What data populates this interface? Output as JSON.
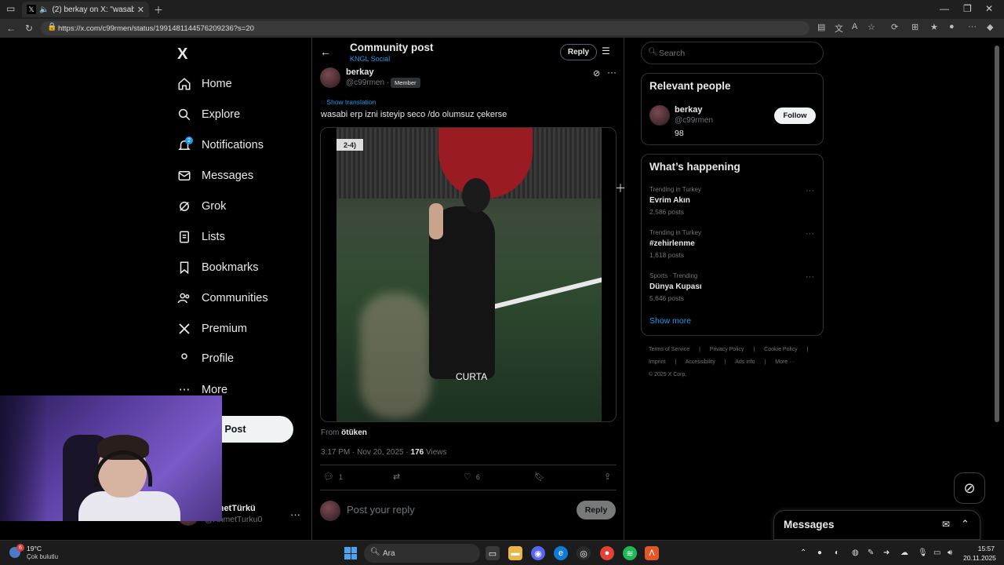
{
  "browser": {
    "tab_title": "(2) berkay on X: \"wasabi erp",
    "url": "https://x.com/c99rmen/status/1991481144576209236?s=20"
  },
  "sidebar": {
    "logo": "X",
    "items": [
      {
        "label": "Home",
        "icon": "home-icon"
      },
      {
        "label": "Explore",
        "icon": "search-icon"
      },
      {
        "label": "Notifications",
        "icon": "bell-icon",
        "badge": "2"
      },
      {
        "label": "Messages",
        "icon": "mail-icon"
      },
      {
        "label": "Grok",
        "icon": "grok-icon"
      },
      {
        "label": "Lists",
        "icon": "list-icon"
      },
      {
        "label": "Bookmarks",
        "icon": "bookmark-icon"
      },
      {
        "label": "Communities",
        "icon": "communities-icon"
      },
      {
        "label": "Premium",
        "icon": "x-premium-icon"
      },
      {
        "label": "Profile",
        "icon": "profile-icon"
      },
      {
        "label": "More",
        "icon": "more-icon"
      }
    ],
    "post_button": "Post",
    "account": {
      "name": "AhmetTürkü",
      "handle": "@AhmetTurku0"
    }
  },
  "header": {
    "title": "Community post",
    "subtitle": "KNGL Social",
    "reply_button": "Reply"
  },
  "post": {
    "author_name": "berkay",
    "author_handle": "@c99rmen ·",
    "member_badge": "Member",
    "show_translation": "Show translation",
    "text": "wasabi erp izni isteyip seco /do olumsuz çekerse",
    "media_score": "2-4)",
    "media_caption": "CURTA",
    "from_label": "From",
    "from_value": "ötüken",
    "timestamp": "3:17 PM · Nov 20, 2025 ·",
    "views_count": "176",
    "views_label": "Views",
    "actions": {
      "replies": "1",
      "likes": "6"
    },
    "reply_placeholder": "Post your reply",
    "reply_button": "Reply"
  },
  "right": {
    "search_placeholder": "Search",
    "relevant_people": {
      "title": "Relevant people",
      "name": "berkay",
      "handle": "@c99rmen",
      "count": "98",
      "follow_button": "Follow"
    },
    "happening": {
      "title": "What’s happening",
      "trends": [
        {
          "context": "Trending in Turkey",
          "topic": "Evrim Akın",
          "posts": "2,586 posts"
        },
        {
          "context": "Trending in Turkey",
          "topic": "#zehirlenme",
          "posts": "1,618 posts"
        },
        {
          "context": "Sports · Trending",
          "topic": "Dünya Kupası",
          "posts": "5,646 posts"
        }
      ],
      "show_more": "Show more"
    },
    "footer_links": [
      "Terms of Service",
      "|",
      "Privacy Policy",
      "|",
      "Cookie Policy",
      "|",
      "Imprint",
      "|",
      "Accessibility",
      "|",
      "Ads info",
      "|",
      "More ···"
    ],
    "copyright": "© 2025 X Corp.",
    "messages_drawer": "Messages"
  },
  "taskbar": {
    "temperature": "19°C",
    "condition": "Çok bulutlu",
    "weather_badge": "6",
    "search": "Ara",
    "time": "15:57",
    "date": "20.11.2025"
  }
}
